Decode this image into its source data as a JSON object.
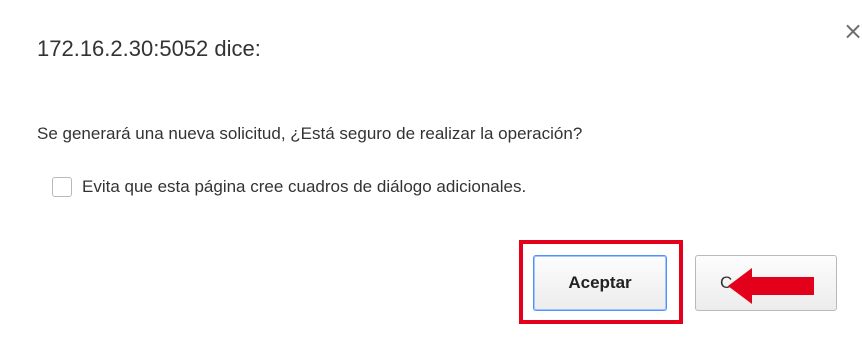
{
  "dialog": {
    "title": "172.16.2.30:5052 dice:",
    "message": "Se generará una nueva solicitud, ¿Está seguro de realizar la operación?",
    "suppress_label": "Evita que esta página cree cuadros de diálogo adicionales.",
    "suppress_checked": false,
    "close_icon": "×",
    "accept_label": "Aceptar",
    "cancel_label_visible": "C"
  },
  "annotations": {
    "highlight_color": "#e3001b",
    "arrow_color": "#e3001b",
    "arrow_icon": "arrow-left-icon"
  },
  "colors": {
    "focus_border": "#4d90fe",
    "text": "#333333"
  }
}
